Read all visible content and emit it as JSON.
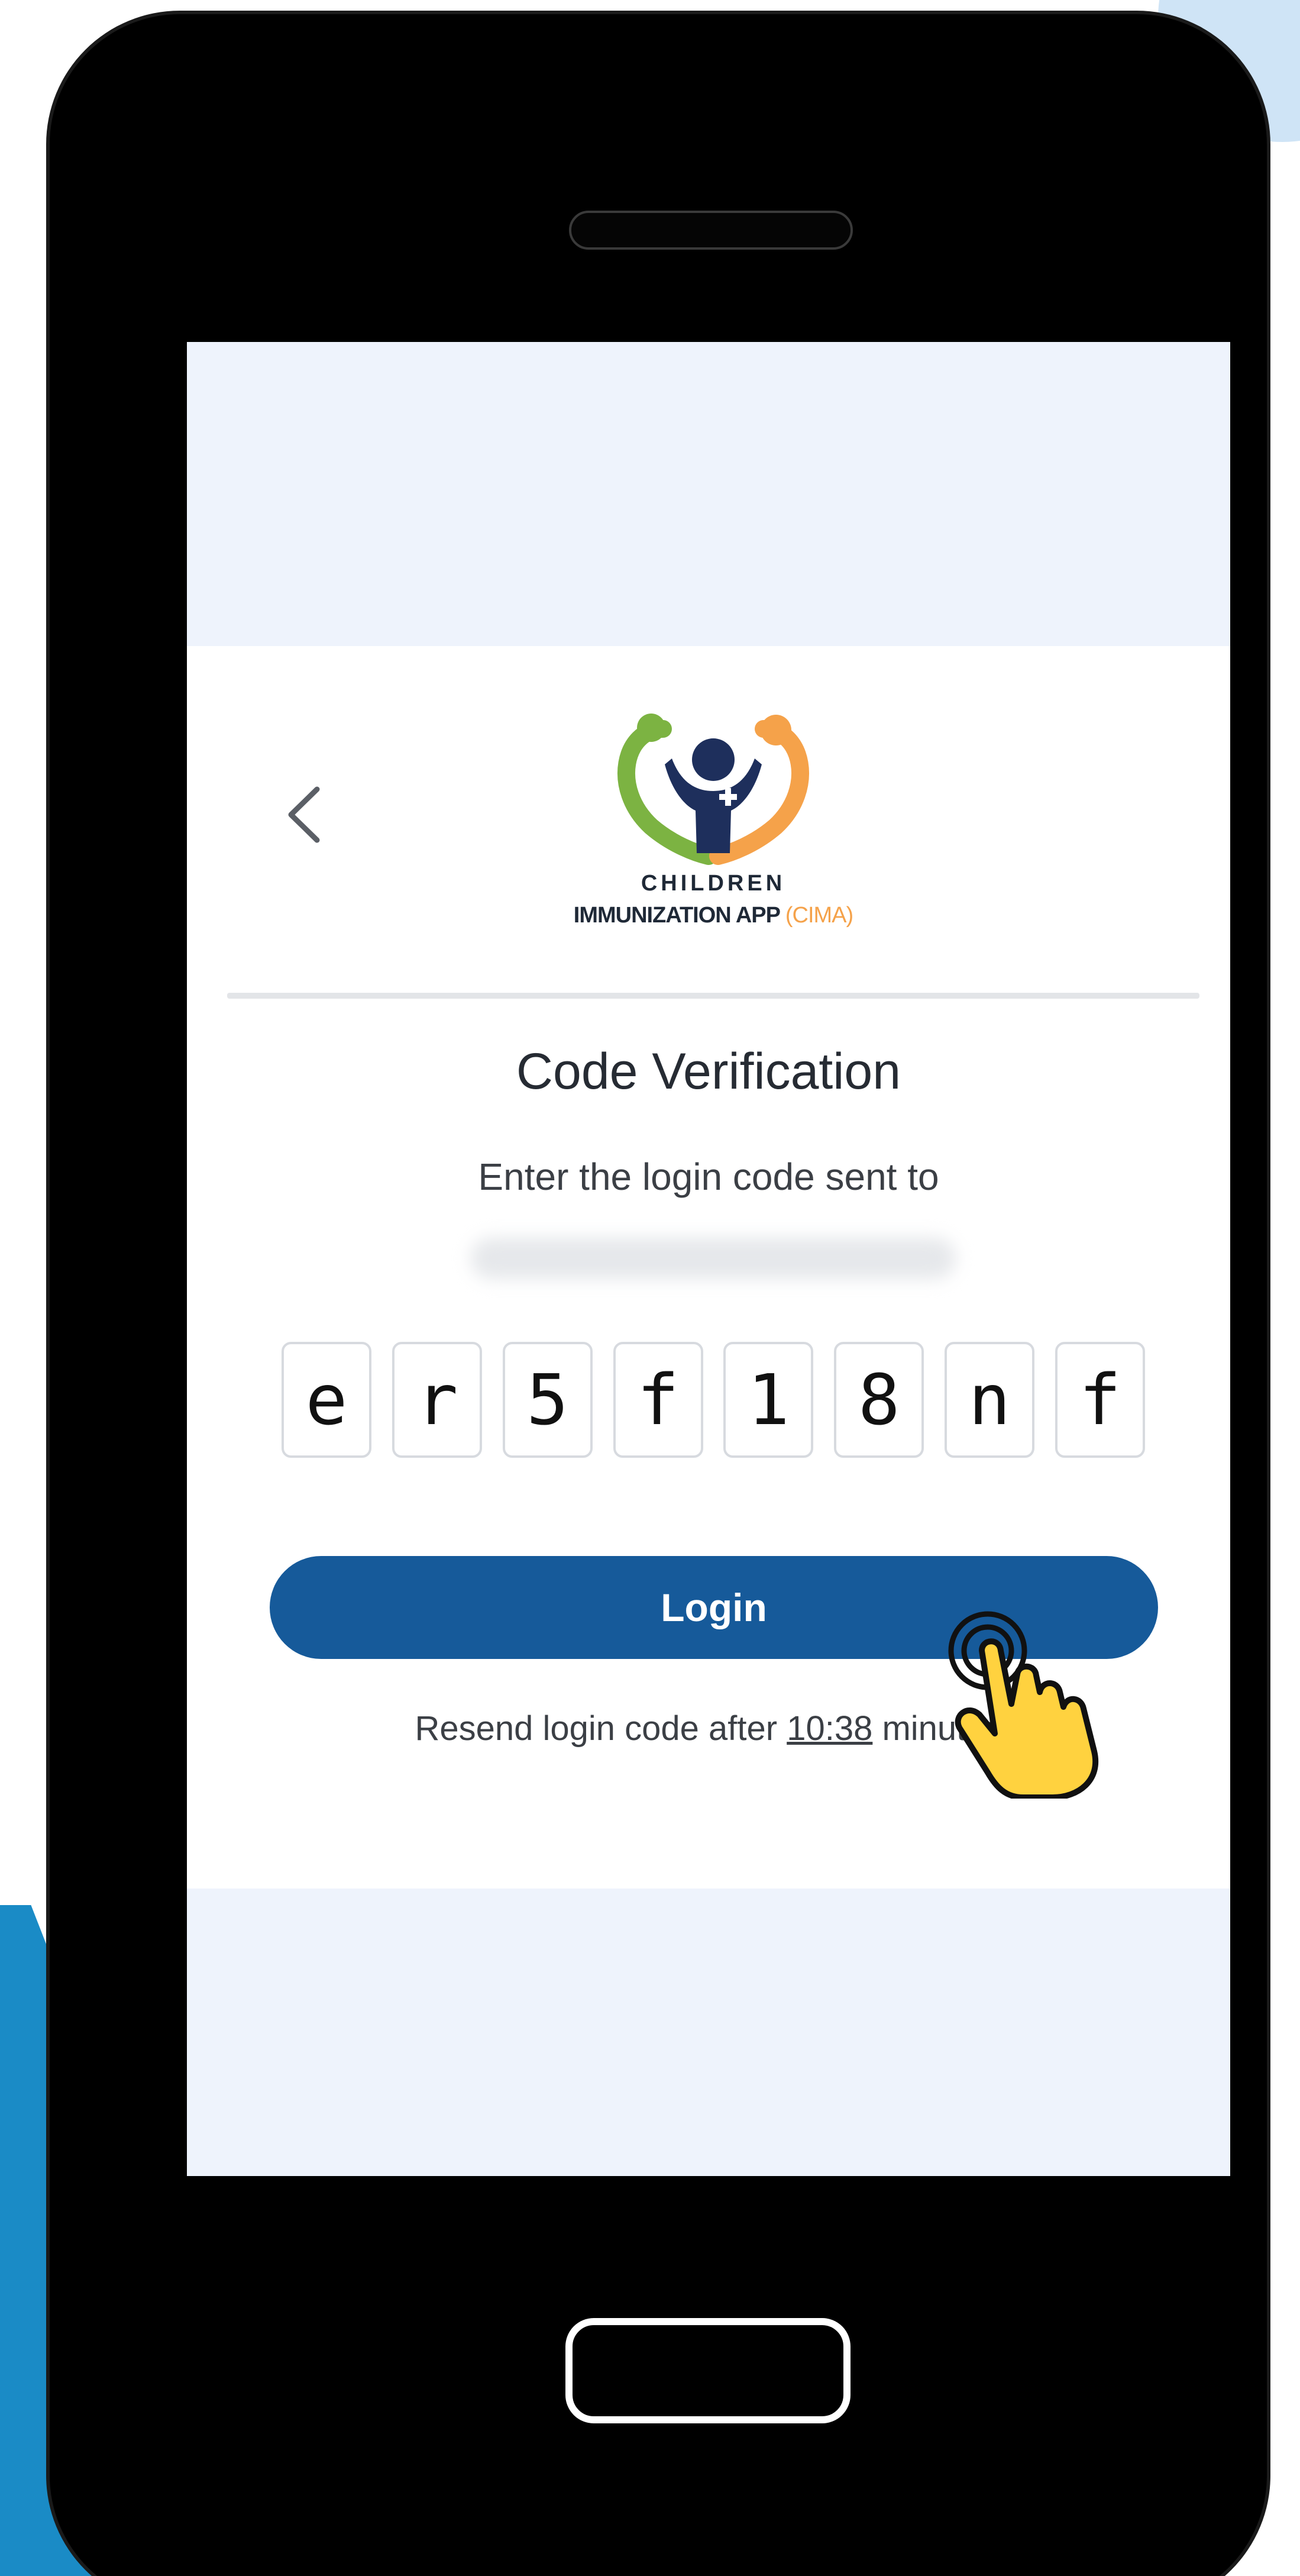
{
  "logo": {
    "line1": "CHILDREN",
    "line2_main": "IMMUNIZATION APP ",
    "line2_accent": "(CIMA)",
    "colors": {
      "left_arm": "#7cb342",
      "right_arm": "#f5a24a",
      "figure": "#1e2f5c"
    }
  },
  "header": {
    "back_icon": "chevron-left-icon"
  },
  "verification": {
    "title": "Code Verification",
    "subtitle": "Enter the login code sent to",
    "code_digits": [
      "e",
      "r",
      "5",
      "f",
      "1",
      "8",
      "n",
      "f"
    ]
  },
  "actions": {
    "login_label": "Login",
    "login_color": "#165a9a"
  },
  "resend": {
    "prefix": "Resend login code after ",
    "timer": "10:38",
    "suffix": " minutes"
  },
  "overlay": {
    "pointer_icon": "tap-hand-icon"
  }
}
